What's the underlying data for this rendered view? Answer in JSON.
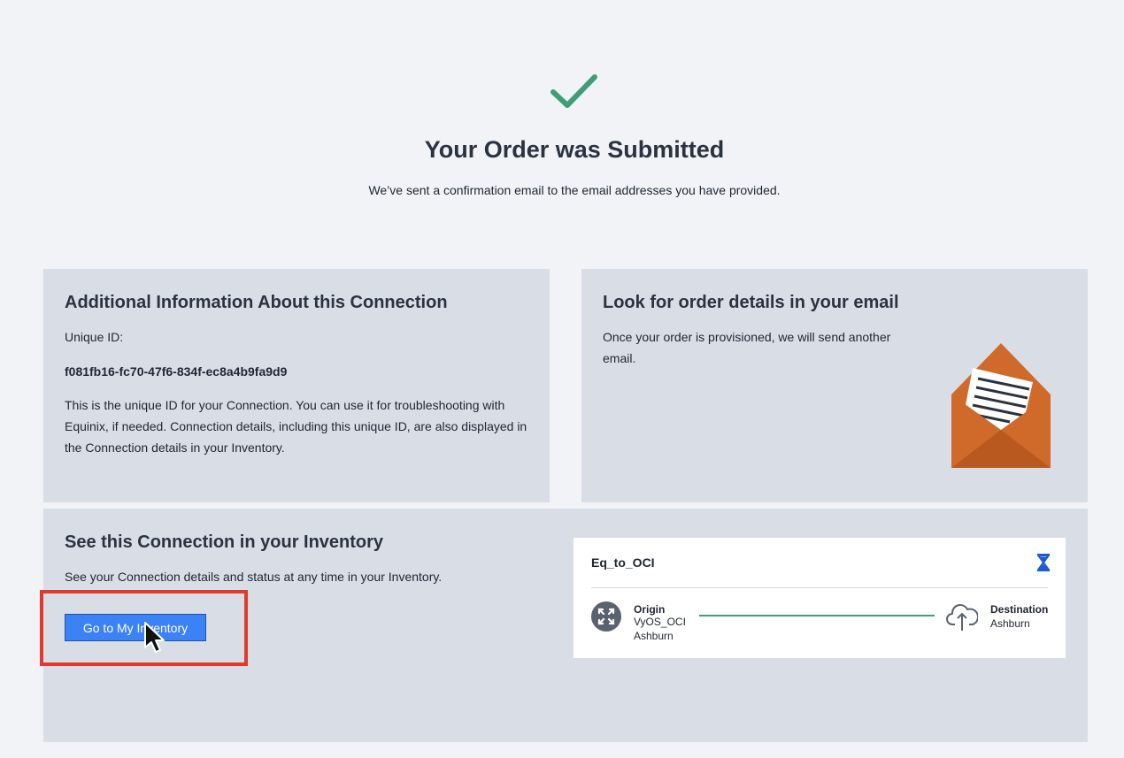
{
  "header": {
    "title": "Your Order was Submitted",
    "subtitle": "We’ve sent a confirmation email to the email addresses you have provided.",
    "success_icon": "check-icon",
    "success_color": "#3f9e78"
  },
  "additional_info": {
    "heading": "Additional Information About this Connection",
    "unique_id_label": "Unique ID:",
    "unique_id": "f081fb16-fc70-47f6-834f-ec8a4b9fa9d9",
    "description": "This is the unique ID for your Connection. You can use it for troubleshooting with Equinix, if needed. Connection details, including this unique ID, are also displayed in the Connection details in your Inventory."
  },
  "email_panel": {
    "heading": "Look for order details in your email",
    "text": "Once your order is provisioned, we will send another email.",
    "illustration": "envelope-letter-icon",
    "envelope_color": "#cf6a2b"
  },
  "inventory": {
    "heading": "See this Connection in your Inventory",
    "text": "See your Connection details and status at any time in your Inventory.",
    "button_label": "Go to My Inventory",
    "button_color": "#3b82f6"
  },
  "connection_card": {
    "name": "Eq_to_OCI",
    "status_icon": "hourglass-icon",
    "origin_label": "Origin",
    "origin_name": "VyOS_OCI",
    "origin_location": "Ashburn",
    "destination_label": "Destination",
    "destination_location": "Ashburn",
    "origin_icon": "network-hub-icon",
    "destination_icon": "cloud-upload-icon",
    "line_color": "#3aa27e"
  }
}
